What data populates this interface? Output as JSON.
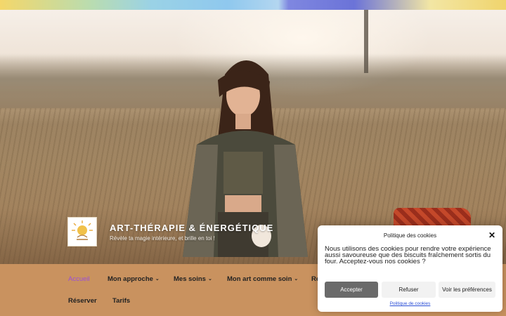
{
  "site": {
    "title": "Art-Thérapie & Énergétique",
    "tagline": "Révèle ta magie intérieure, et brille en toi !"
  },
  "nav": {
    "items": [
      {
        "label": "Accueil",
        "active": true
      },
      {
        "label": "Mon approche",
        "dropdown": true
      },
      {
        "label": "Mes soins",
        "dropdown": true
      },
      {
        "label": "Mon art comme soin",
        "dropdown": true
      },
      {
        "label": "Re"
      },
      {
        "label": "Réserver"
      },
      {
        "label": "Tarifs"
      }
    ],
    "chevron": "⌄"
  },
  "cookie_banner": {
    "title": "Politique des cookies",
    "close_symbol": "✕",
    "message": "Nous utilisons des cookies pour rendre votre expérience aussi savoureuse que des biscuits fraîchement sortis du four. Acceptez-vous nos cookies ?",
    "accept_label": "Accepter",
    "refuse_label": "Refuser",
    "preferences_label": "Voir les préférences",
    "policy_link": "Politique de cookies"
  },
  "colors": {
    "nav_background": "#c9925f",
    "active_link": "#9b4fd6",
    "accept_button": "#6a6a6a",
    "link": "#2b4fd6"
  },
  "icons": [
    "close-icon",
    "chevron-down-icon",
    "logo-sun-icon"
  ]
}
